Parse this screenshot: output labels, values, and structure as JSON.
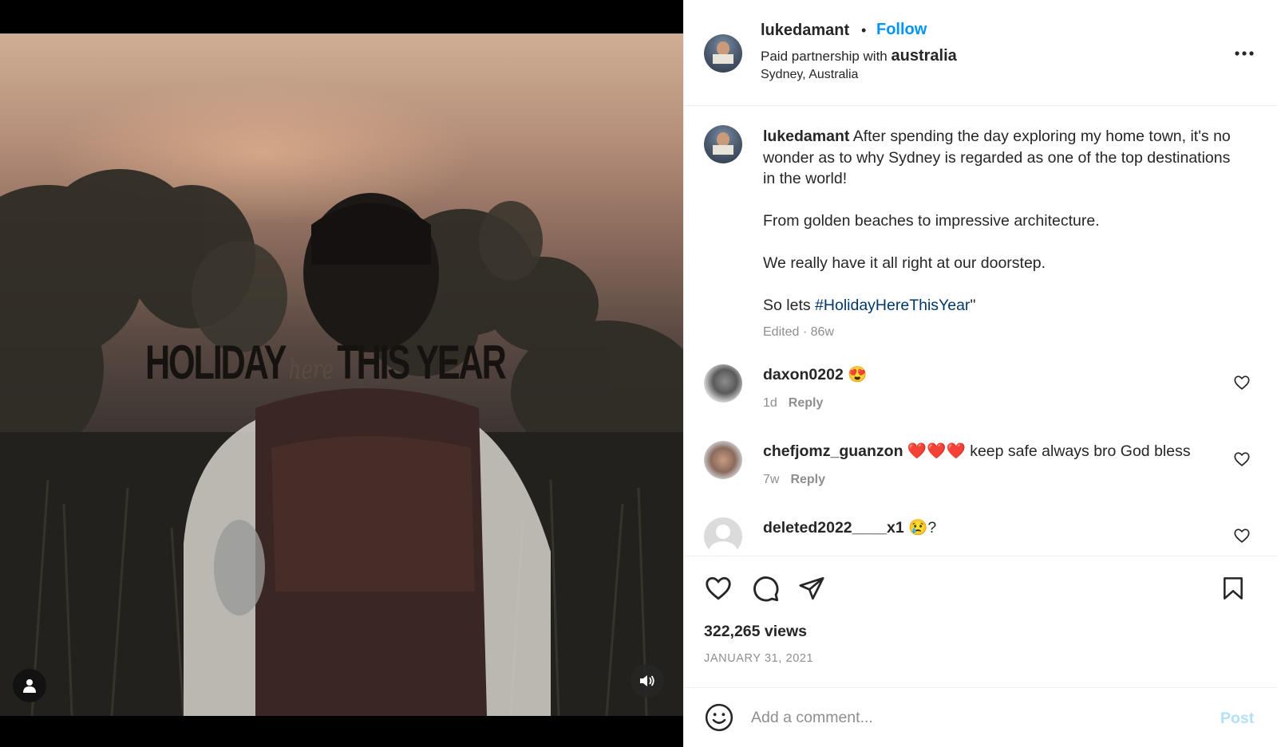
{
  "video": {
    "overlay_left": "HOLIDAY",
    "overlay_mid": "here",
    "overlay_right": "THIS YEAR",
    "icons": {
      "user_tag": "user-icon",
      "audio": "speaker-icon"
    }
  },
  "header": {
    "username": "lukedamant",
    "dot": "•",
    "follow_label": "Follow",
    "partnership_prefix": "Paid partnership with ",
    "partner": "australia",
    "location": "Sydney, Australia",
    "more_icon": "more-horizontal-icon"
  },
  "caption": {
    "username": "lukedamant",
    "line1": " After spending the day exploring my home town, it's no wonder as to why Sydney is regarded as one of the top destinations in the world!",
    "line2": "From golden beaches to impressive architecture.",
    "line3": "We really have it all right at our doorstep.",
    "line4_prefix": "So lets ",
    "hashtag": "#HolidayHereThisYear",
    "line4_suffix": "\"",
    "meta": "Edited · 86w"
  },
  "comments": [
    {
      "username": "daxon0202",
      "text": " 😍",
      "age": "1d",
      "reply": "Reply"
    },
    {
      "username": "chefjomz_guanzon",
      "text": " ❤️❤️❤️ keep safe always bro God bless",
      "age": "7w",
      "reply": "Reply"
    },
    {
      "username": "deleted2022____x1",
      "text": " 😢?",
      "age": "",
      "reply": ""
    }
  ],
  "actions": {
    "icons": [
      "heart-icon",
      "comment-icon",
      "share-icon",
      "bookmark-icon"
    ],
    "views": "322,265 views",
    "date": "JANUARY 31, 2021"
  },
  "add_comment": {
    "placeholder": "Add a comment...",
    "post_label": "Post"
  },
  "colors": {
    "link": "#0095f6",
    "hashtag": "#00376b",
    "muted": "#8e8e8e",
    "post_disabled": "#b2dffc"
  }
}
